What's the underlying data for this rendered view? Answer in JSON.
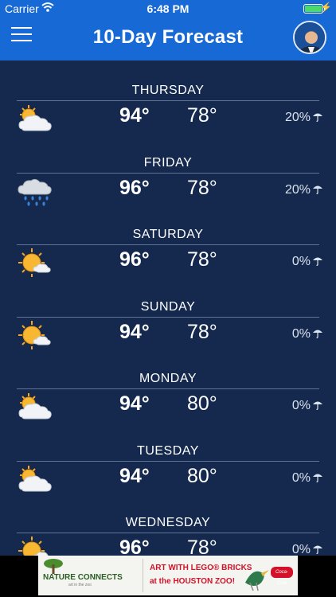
{
  "status": {
    "carrier": "Carrier",
    "time": "6:48 PM"
  },
  "header": {
    "title": "10-Day Forecast"
  },
  "days": [
    {
      "name": "THURSDAY",
      "hi": "94°",
      "lo": "78°",
      "precip": "20%",
      "icon": "partly-cloudy-icon"
    },
    {
      "name": "FRIDAY",
      "hi": "96°",
      "lo": "78°",
      "precip": "20%",
      "icon": "rain-cloud-icon"
    },
    {
      "name": "SATURDAY",
      "hi": "96°",
      "lo": "78°",
      "precip": "0%",
      "icon": "mostly-sunny-icon"
    },
    {
      "name": "SUNDAY",
      "hi": "94°",
      "lo": "78°",
      "precip": "0%",
      "icon": "mostly-sunny-icon"
    },
    {
      "name": "MONDAY",
      "hi": "94°",
      "lo": "80°",
      "precip": "0%",
      "icon": "partly-cloudy-icon"
    },
    {
      "name": "TUESDAY",
      "hi": "94°",
      "lo": "80°",
      "precip": "0%",
      "icon": "partly-cloudy-icon"
    },
    {
      "name": "WEDNESDAY",
      "hi": "96°",
      "lo": "78°",
      "precip": "0%",
      "icon": "mostly-sunny-icon"
    }
  ],
  "ad": {
    "left_text": "NATURE CONNECTS",
    "left_sub": "art in the zoo",
    "line1": "ART WITH LEGO® BRICKS",
    "line2": "at the HOUSTON ZOO!",
    "sponsor": "Coca-Cola"
  },
  "colors": {
    "header": "#1769d6",
    "background": "#14294d",
    "divider": "#5f7394"
  }
}
